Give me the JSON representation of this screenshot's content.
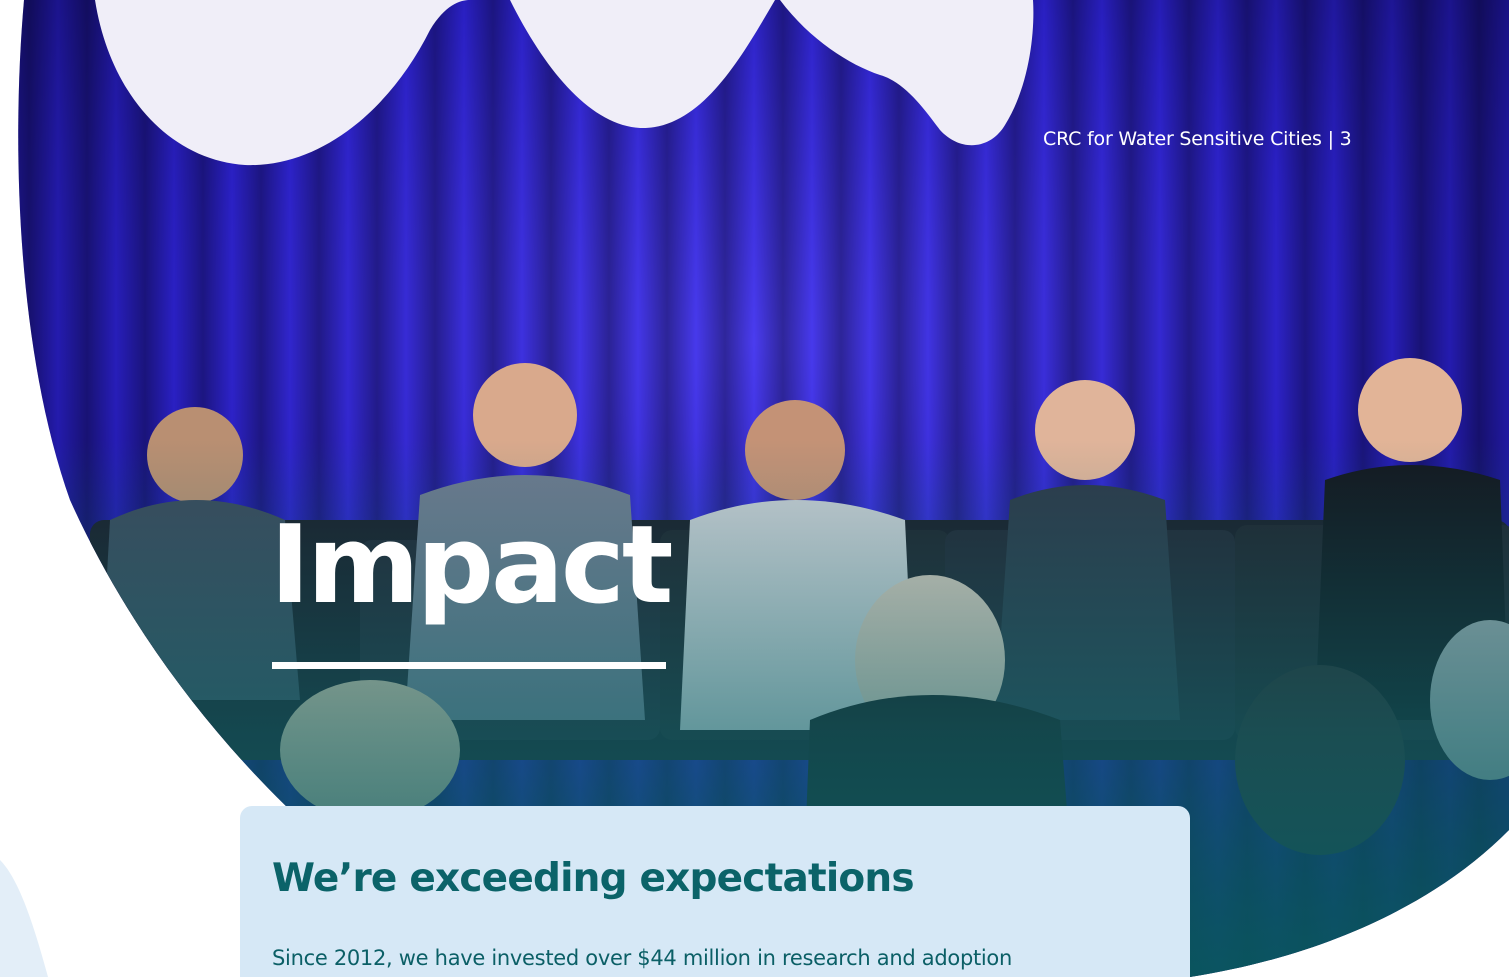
{
  "page_number": "CRC for Water Sensitive Cities | 3",
  "hero": {
    "title": "Impact"
  },
  "card": {
    "heading": "We’re exceeding expectations",
    "body": "Since 2012, we have invested over $44 million in research and adoption"
  },
  "colors": {
    "heading_teal": "#0b6369",
    "card_background": "#d6e8f6",
    "curtain_blue": "#2222c8",
    "overlay_teal": "#0e6a6e",
    "wave_fill": "#f0eef8",
    "side_shape": "#e3eef8"
  }
}
